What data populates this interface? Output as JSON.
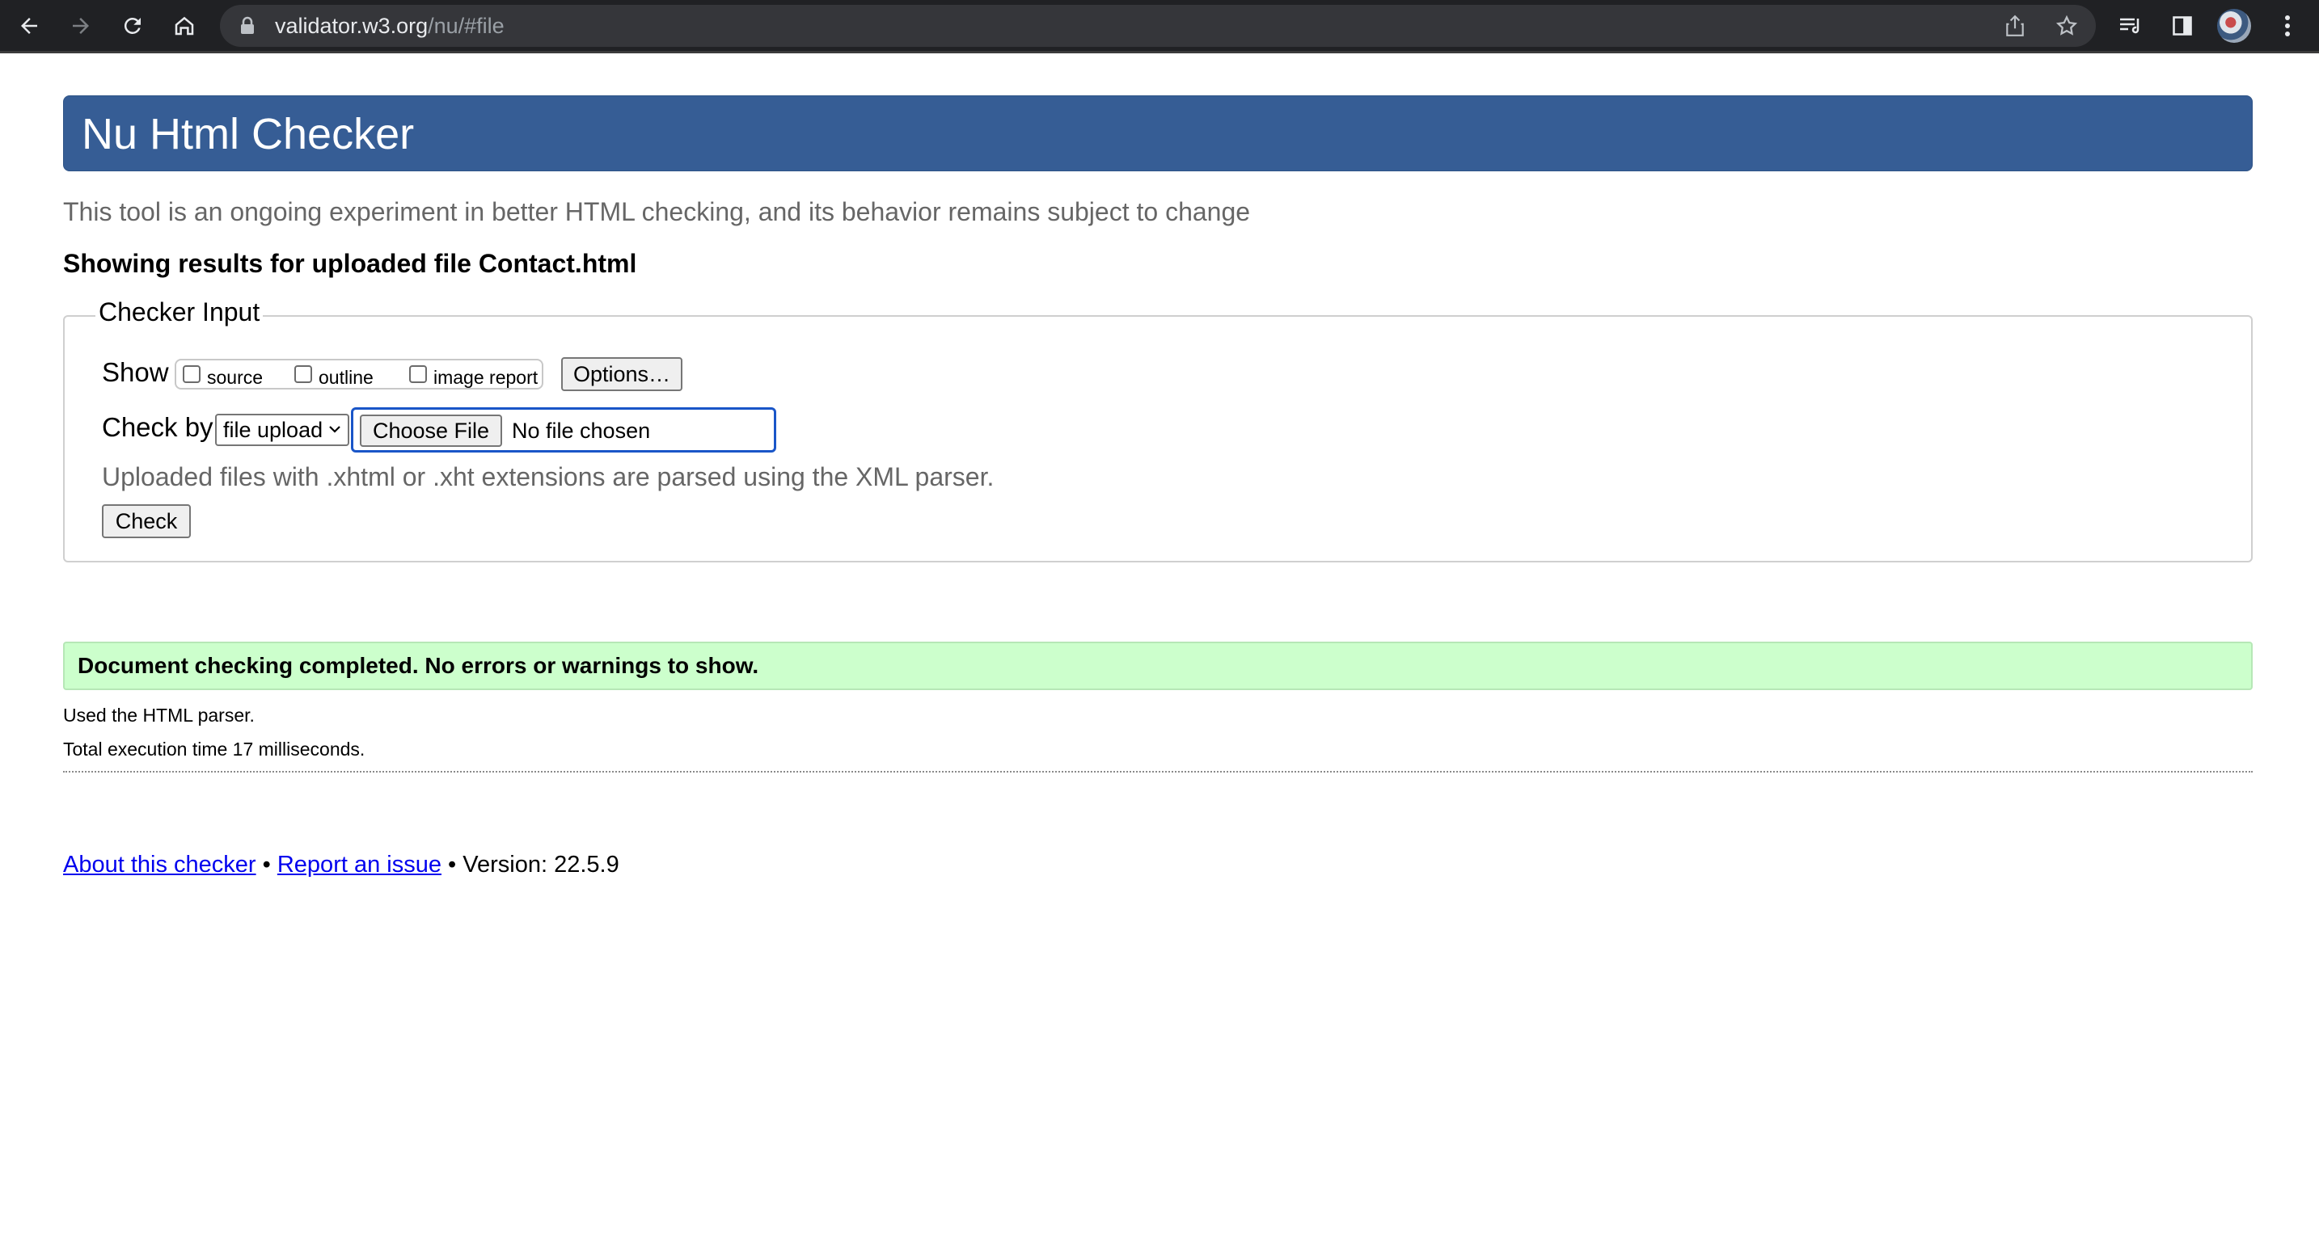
{
  "browser": {
    "url_host": "validator.w3.org",
    "url_path": "/nu/#file",
    "icons": [
      "back-icon",
      "forward-icon",
      "reload-icon",
      "home-icon",
      "lock-icon",
      "share-icon",
      "bookmark-star-icon",
      "reading-list-icon",
      "side-panel-icon",
      "profile-avatar",
      "menu-kebab-icon"
    ]
  },
  "header": {
    "title": "Nu Html Checker",
    "background_color": "#365d95"
  },
  "subtitle": "This tool is an ongoing experiment in better HTML checking, and its behavior remains subject to change",
  "results_heading": "Showing results for uploaded file Contact.html",
  "checker_input": {
    "legend": "Checker Input",
    "show_label": "Show",
    "show_options": [
      {
        "label": "source",
        "checked": false
      },
      {
        "label": "outline",
        "checked": false
      },
      {
        "label": "image report",
        "checked": false
      }
    ],
    "options_button": "Options…",
    "check_by_label": "Check by",
    "check_by_value": "file upload",
    "file_button": "Choose File",
    "file_status": "No file chosen",
    "hint": "Uploaded files with .xhtml or .xht extensions are parsed using the XML parser.",
    "check_button": "Check"
  },
  "result": {
    "message": "Document checking completed. No errors or warnings to show.",
    "background_color": "#ccffcc",
    "parser_note": "Used the HTML parser.",
    "execution_time": "Total execution time 17 milliseconds."
  },
  "footer": {
    "about_link": "About this checker",
    "separator": "•",
    "report_link": "Report an issue",
    "version": "Version: 22.5.9"
  }
}
